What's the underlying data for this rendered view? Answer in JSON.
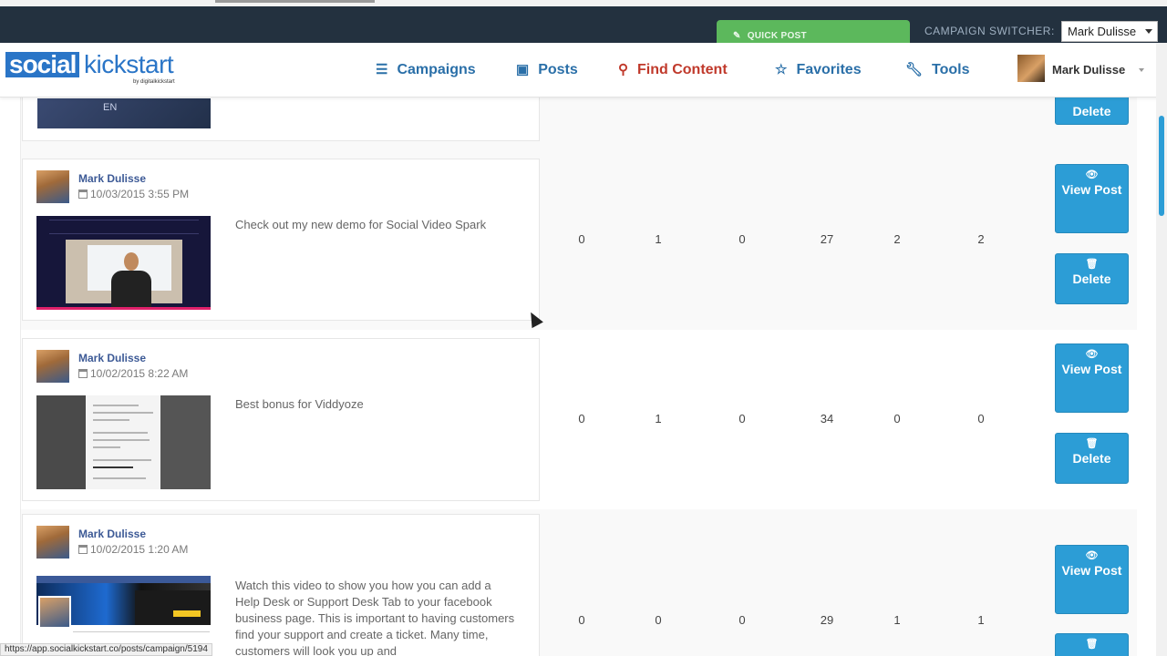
{
  "campaign_bar": {
    "quick_post_label": "QUICK POST",
    "switcher_label": "CAMPAIGN SWITCHER:",
    "switcher_value": "Mark Dulisse"
  },
  "brand": {
    "logo_bold": "social",
    "logo_rest": "kickstart",
    "logo_by": "by digitalkickstart"
  },
  "nav": {
    "campaigns": "Campaigns",
    "posts": "Posts",
    "find_content": "Find Content",
    "favorites": "Favorites",
    "tools": "Tools",
    "user_name": "Mark Dulisse"
  },
  "posts": {
    "partial_thumb_text": "EN",
    "rows": [
      {
        "author": "Mark Dulisse",
        "date": "10/03/2015 3:55 PM",
        "text": "Check out my new demo for Social Video Spark",
        "stats": [
          "0",
          "1",
          "0",
          "27",
          "2",
          "2"
        ]
      },
      {
        "author": "Mark Dulisse",
        "date": "10/02/2015 8:22 AM",
        "text": "Best bonus for Viddyoze",
        "stats": [
          "0",
          "1",
          "0",
          "34",
          "0",
          "0"
        ]
      },
      {
        "author": "Mark Dulisse",
        "date": "10/02/2015 1:20 AM",
        "text": "Watch this video to show you how you can add a Help Desk or Support Desk Tab to your facebook business page. This is important to having customers find your support and create a ticket. Many time, customers will look you up and",
        "stats": [
          "0",
          "0",
          "0",
          "29",
          "1",
          "1"
        ]
      }
    ]
  },
  "buttons": {
    "view_post": "View Post",
    "delete": "Delete"
  },
  "status_url": "https://app.socialkickstart.co/posts/campaign/5194",
  "colors": {
    "nav_blue": "#2a6fa8",
    "active_red": "#c0392b",
    "button_blue": "#2c9dd6",
    "quick_post_green": "#5cb85c",
    "dark_bar": "#23313f"
  }
}
